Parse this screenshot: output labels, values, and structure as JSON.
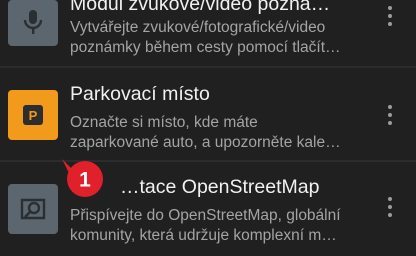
{
  "plugins": [
    {
      "title": "Modul zvukové/video pozná…",
      "desc_line1": "Vytvářejte zvukové/fotografické/video",
      "desc_line2": "poznámky během cesty pomocí tlačít…",
      "icon": "microphone-icon",
      "tile_color": "#5c666e"
    },
    {
      "title": "Parkovací místo",
      "desc_line1": "Označte si místo, kde máte",
      "desc_line2": "zaparkované auto, a upozorněte kale…",
      "icon": "parking-icon",
      "icon_letter": "P",
      "tile_color": "#f29a1c"
    },
    {
      "title": "…tace OpenStreetMap",
      "desc_line1": "Přispívejte do OpenStreetMap, globální",
      "desc_line2": "komunity, která udržuje komplexní m…",
      "icon": "osm-edit-icon",
      "tile_color": "#5c666e"
    }
  ],
  "annotation": {
    "step_number": "1",
    "color": "#e0202a"
  }
}
